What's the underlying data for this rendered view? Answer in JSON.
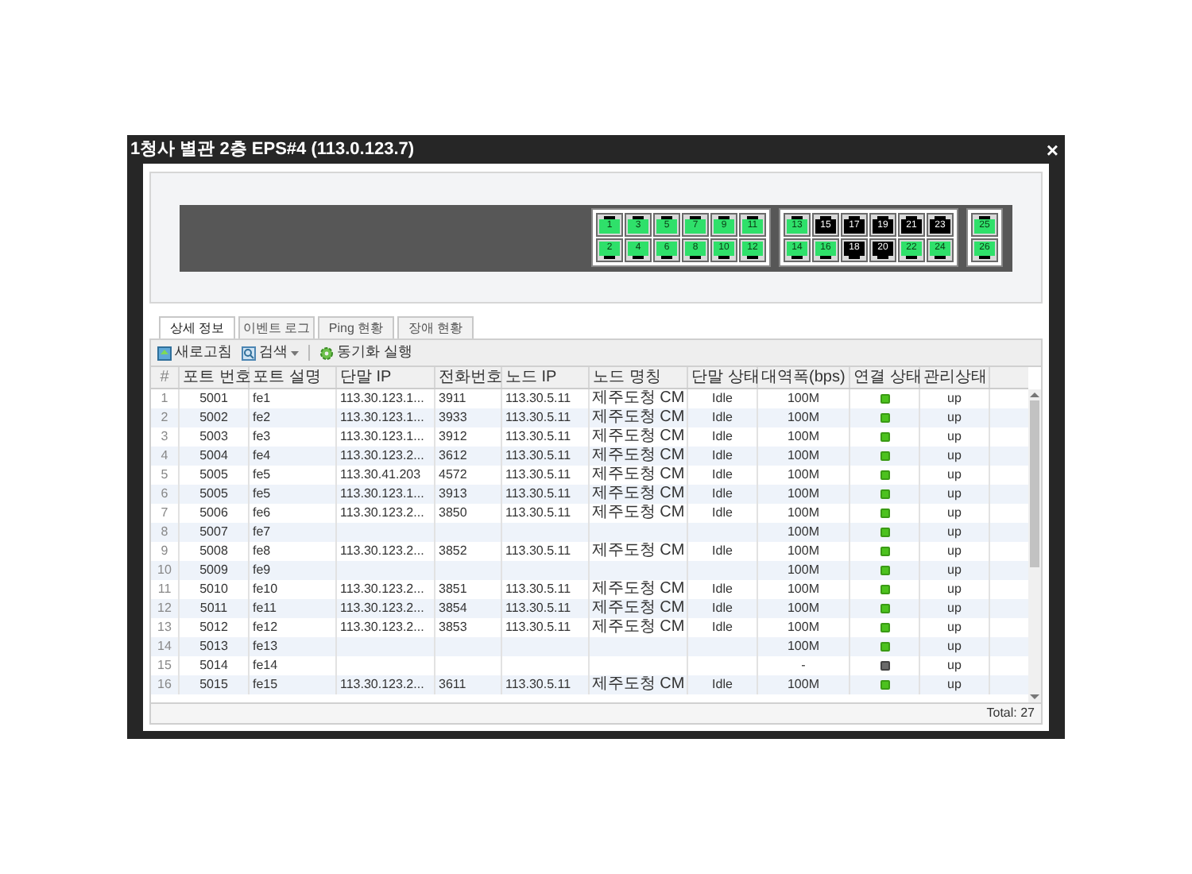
{
  "dialog": {
    "title": "1청사 별관 2층 EPS#4 (113.0.123.7)",
    "close": "×"
  },
  "port_groups": [
    {
      "ports": [
        {
          "label": "1",
          "up": true
        },
        {
          "label": "2",
          "up": true
        },
        {
          "label": "3",
          "up": true
        },
        {
          "label": "4",
          "up": true
        },
        {
          "label": "5",
          "up": true
        },
        {
          "label": "6",
          "up": true
        },
        {
          "label": "7",
          "up": true
        },
        {
          "label": "8",
          "up": true
        },
        {
          "label": "9",
          "up": true
        },
        {
          "label": "10",
          "up": true
        },
        {
          "label": "11",
          "up": true
        },
        {
          "label": "12",
          "up": true
        }
      ]
    },
    {
      "ports": [
        {
          "label": "13",
          "up": true
        },
        {
          "label": "14",
          "up": true
        },
        {
          "label": "15",
          "up": false
        },
        {
          "label": "16",
          "up": true
        },
        {
          "label": "17",
          "up": false
        },
        {
          "label": "18",
          "up": false
        },
        {
          "label": "19",
          "up": false
        },
        {
          "label": "20",
          "up": false
        },
        {
          "label": "21",
          "up": false
        },
        {
          "label": "22",
          "up": true
        },
        {
          "label": "23",
          "up": false
        },
        {
          "label": "24",
          "up": true
        }
      ]
    },
    {
      "ports": [
        {
          "label": "25",
          "up": true
        },
        {
          "label": "26",
          "up": true
        }
      ]
    }
  ],
  "tabs": [
    {
      "label": "상세 정보",
      "selected": true
    },
    {
      "label": "이벤트 로그",
      "selected": false
    },
    {
      "label": "Ping 현황",
      "selected": false
    },
    {
      "label": "장애 현황",
      "selected": false
    }
  ],
  "toolbar": {
    "refresh": "새로고침",
    "search": "검색",
    "sync": "동기화 실행"
  },
  "table": {
    "columns": [
      "#",
      "포트 번호",
      "포트 설명",
      "단말 IP",
      "전화번호",
      "노드 IP",
      "노드 명칭",
      "단말 상태",
      "대역폭(bps)",
      "연결 상태",
      "관리상태"
    ],
    "rows": [
      {
        "no": "1",
        "port": "5001",
        "desc": "fe1",
        "ip": "113.30.123.1...",
        "phone": "3911",
        "node_ip": "113.30.5.11",
        "node": "제주도청 CM",
        "state": "Idle",
        "bw": "100M",
        "connected": true,
        "admin": "up"
      },
      {
        "no": "2",
        "port": "5002",
        "desc": "fe2",
        "ip": "113.30.123.1...",
        "phone": "3933",
        "node_ip": "113.30.5.11",
        "node": "제주도청 CM",
        "state": "Idle",
        "bw": "100M",
        "connected": true,
        "admin": "up"
      },
      {
        "no": "3",
        "port": "5003",
        "desc": "fe3",
        "ip": "113.30.123.1...",
        "phone": "3912",
        "node_ip": "113.30.5.11",
        "node": "제주도청 CM",
        "state": "Idle",
        "bw": "100M",
        "connected": true,
        "admin": "up"
      },
      {
        "no": "4",
        "port": "5004",
        "desc": "fe4",
        "ip": "113.30.123.2...",
        "phone": "3612",
        "node_ip": "113.30.5.11",
        "node": "제주도청 CM",
        "state": "Idle",
        "bw": "100M",
        "connected": true,
        "admin": "up"
      },
      {
        "no": "5",
        "port": "5005",
        "desc": "fe5",
        "ip": "113.30.41.203",
        "phone": "4572",
        "node_ip": "113.30.5.11",
        "node": "제주도청 CM",
        "state": "Idle",
        "bw": "100M",
        "connected": true,
        "admin": "up"
      },
      {
        "no": "6",
        "port": "5005",
        "desc": "fe5",
        "ip": "113.30.123.1...",
        "phone": "3913",
        "node_ip": "113.30.5.11",
        "node": "제주도청 CM",
        "state": "Idle",
        "bw": "100M",
        "connected": true,
        "admin": "up"
      },
      {
        "no": "7",
        "port": "5006",
        "desc": "fe6",
        "ip": "113.30.123.2...",
        "phone": "3850",
        "node_ip": "113.30.5.11",
        "node": "제주도청 CM",
        "state": "Idle",
        "bw": "100M",
        "connected": true,
        "admin": "up"
      },
      {
        "no": "8",
        "port": "5007",
        "desc": "fe7",
        "bw": "100M",
        "connected": true,
        "admin": "up"
      },
      {
        "no": "9",
        "port": "5008",
        "desc": "fe8",
        "ip": "113.30.123.2...",
        "phone": "3852",
        "node_ip": "113.30.5.11",
        "node": "제주도청 CM",
        "state": "Idle",
        "bw": "100M",
        "connected": true,
        "admin": "up"
      },
      {
        "no": "10",
        "port": "5009",
        "desc": "fe9",
        "bw": "100M",
        "connected": true,
        "admin": "up"
      },
      {
        "no": "11",
        "port": "5010",
        "desc": "fe10",
        "ip": "113.30.123.2...",
        "phone": "3851",
        "node_ip": "113.30.5.11",
        "node": "제주도청 CM",
        "state": "Idle",
        "bw": "100M",
        "connected": true,
        "admin": "up"
      },
      {
        "no": "12",
        "port": "5011",
        "desc": "fe11",
        "ip": "113.30.123.2...",
        "phone": "3854",
        "node_ip": "113.30.5.11",
        "node": "제주도청 CM",
        "state": "Idle",
        "bw": "100M",
        "connected": true,
        "admin": "up"
      },
      {
        "no": "13",
        "port": "5012",
        "desc": "fe12",
        "ip": "113.30.123.2...",
        "phone": "3853",
        "node_ip": "113.30.5.11",
        "node": "제주도청 CM",
        "state": "Idle",
        "bw": "100M",
        "connected": true,
        "admin": "up"
      },
      {
        "no": "14",
        "port": "5013",
        "desc": "fe13",
        "bw": "100M",
        "connected": true,
        "admin": "up"
      },
      {
        "no": "15",
        "port": "5014",
        "desc": "fe14",
        "bw": "-",
        "connected": false,
        "admin": "up"
      },
      {
        "no": "16",
        "port": "5015",
        "desc": "fe15",
        "ip": "113.30.123.2...",
        "phone": "3611",
        "node_ip": "113.30.5.11",
        "node": "제주도청 CM",
        "state": "Idle",
        "bw": "100M",
        "connected": true,
        "admin": "up"
      }
    ],
    "total": "Total: 27"
  }
}
